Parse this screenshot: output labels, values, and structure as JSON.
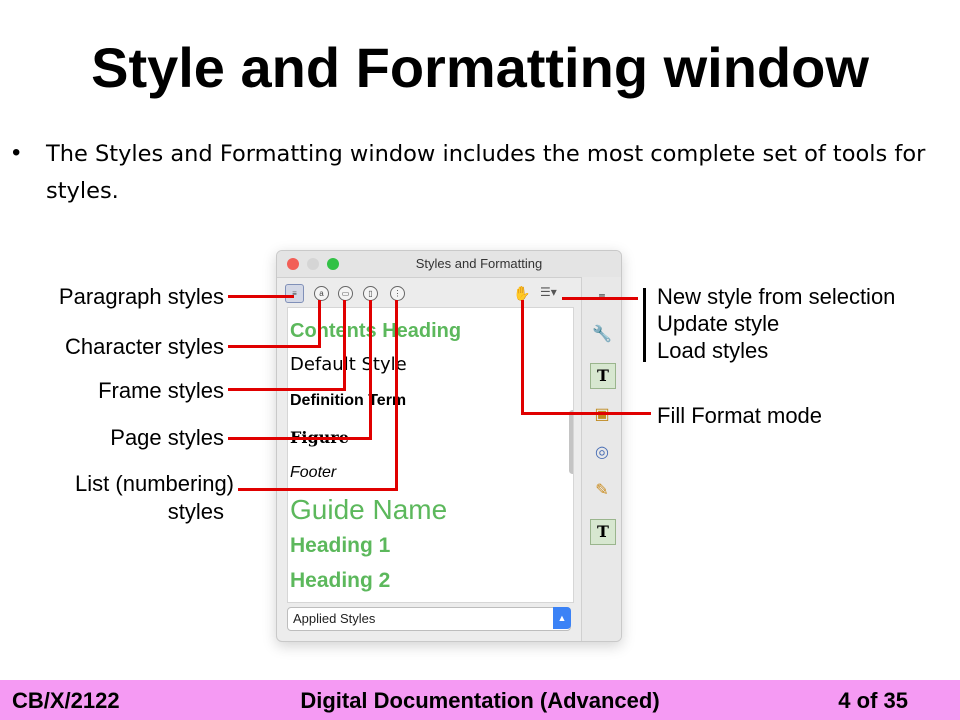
{
  "slide": {
    "title": "Style and Formatting window",
    "bullet": "The Styles and Formatting window includes the most complete set of tools for styles."
  },
  "window": {
    "title": "Styles and Formatting",
    "style_list": [
      {
        "name": "Contents Heading",
        "color": "#5cb85c"
      },
      {
        "name": "Default Style",
        "color": "#111111"
      },
      {
        "name": "Definition Term",
        "color": "#111111"
      },
      {
        "name": "Figure",
        "color": "#111111"
      },
      {
        "name": "Footer",
        "color": "#111111"
      },
      {
        "name": "Guide Name",
        "color": "#5cb85c"
      },
      {
        "name": "Heading 1",
        "color": "#5cb85c"
      },
      {
        "name": "Heading 2",
        "color": "#5cb85c"
      }
    ],
    "filter_value": "Applied Styles",
    "toolbar_icons": [
      "paragraph-styles-icon",
      "character-styles-icon",
      "frame-styles-icon",
      "page-styles-icon",
      "list-styles-icon",
      "fill-format-icon",
      "style-actions-menu-icon"
    ],
    "sidebar_icons": [
      "menu-icon",
      "wrench-icon",
      "text-style-icon",
      "briefcase-icon",
      "compass-icon",
      "edit-icon",
      "text-style-icon"
    ]
  },
  "annotations": {
    "left": [
      "Paragraph styles",
      "Character styles",
      "Frame styles",
      "Page styles",
      "List (numbering)",
      "styles"
    ],
    "right": [
      "New style from selection",
      "Update style",
      "Load styles",
      "Fill Format mode"
    ]
  },
  "footer": {
    "code": "CB/X/2122",
    "course": "Digital Documentation (Advanced)",
    "page": "4 of 35"
  },
  "colors": {
    "accent_green": "#5cb85c",
    "annotation_red": "#e00000",
    "footer_bg": "#f59af3"
  }
}
